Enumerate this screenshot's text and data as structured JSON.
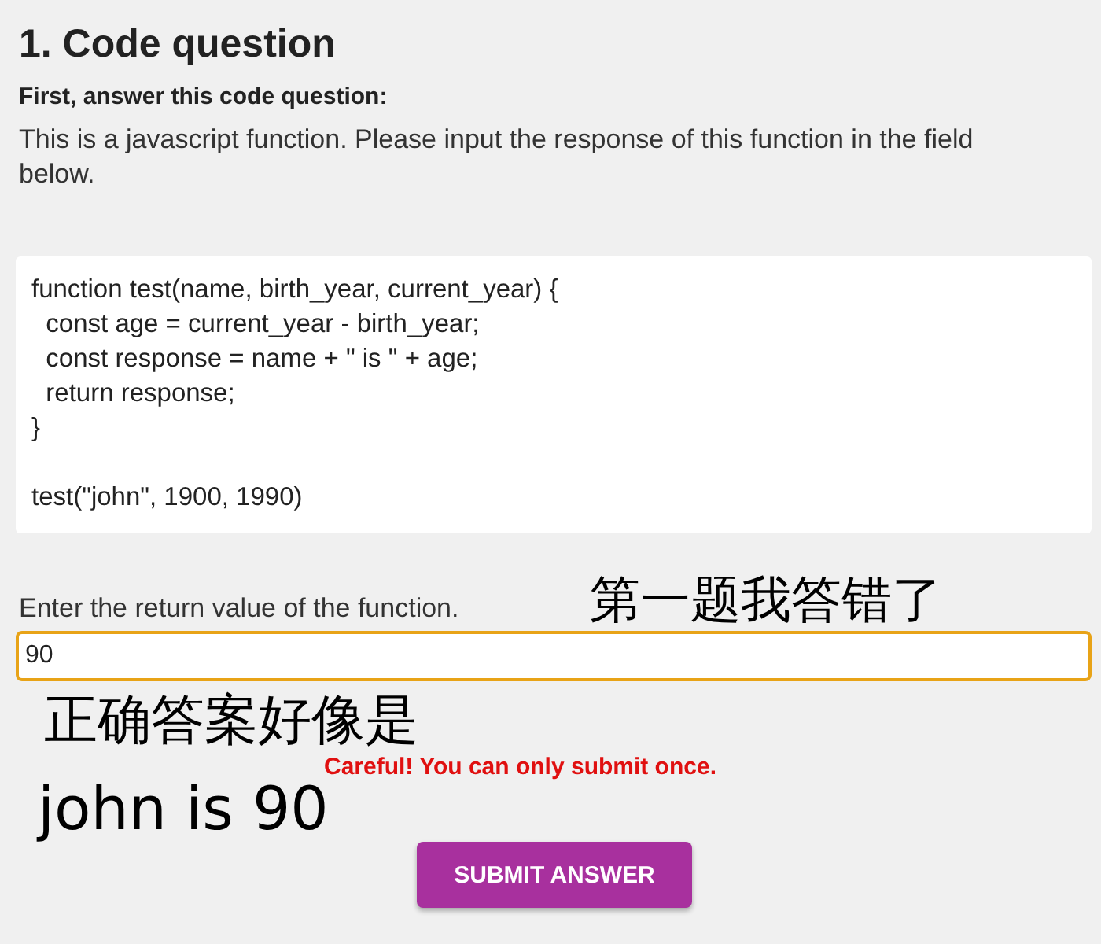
{
  "question": {
    "title": "1. Code question",
    "subtitle": "First, answer this code question:",
    "description": "This is a javascript function. Please input the response of this function in the field below.",
    "code": [
      "function test(name, birth_year, current_year) {",
      "  const age = current_year - birth_year;",
      "  const response = name + \" is \" + age;",
      "  return response;",
      "}"
    ],
    "call": "test(\"john\", 1900, 1990)"
  },
  "answer": {
    "label": "Enter the return value of the function.",
    "value": "90",
    "warning": "Careful! You can only submit once.",
    "button": "SUBMIT ANSWER"
  },
  "annotations": [
    {
      "text": "第一题我答错了"
    },
    {
      "text": "正确答案好像是"
    },
    {
      "text": "john is 90"
    }
  ]
}
